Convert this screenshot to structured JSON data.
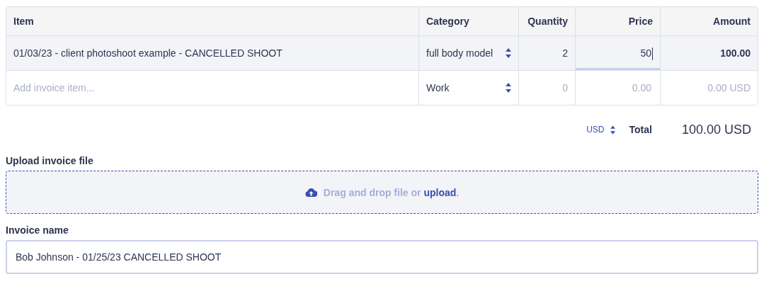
{
  "table": {
    "columns": [
      {
        "label": "Item"
      },
      {
        "label": "Category"
      },
      {
        "label": "Quantity"
      },
      {
        "label": "Price"
      },
      {
        "label": "Amount"
      }
    ],
    "rows": [
      {
        "kind": "item",
        "item": {
          "value": "01/03/23 - client photoshoot example - CANCELLED SHOOT"
        },
        "category": "full body model",
        "quantity": {
          "value": "2"
        },
        "price": {
          "value": "50",
          "focused": true
        },
        "amount": {
          "value": "100.00"
        }
      },
      {
        "kind": "new",
        "item": {
          "placeholder": "Add invoice item..."
        },
        "category": "Work",
        "quantity": {
          "placeholder": "0"
        },
        "price": {
          "placeholder": "0.00",
          "focused": false
        },
        "amount": {
          "placeholder": "0.00 USD"
        }
      }
    ]
  },
  "totals": {
    "currency": "USD",
    "label": "Total",
    "value": "100.00 USD"
  },
  "upload": {
    "label": "Upload invoice file",
    "prompt": "Drag and drop file or",
    "link": "upload",
    "suffix": "."
  },
  "invoice_name": {
    "label": "Invoice name",
    "value": "Bob Johnson - 01/25/23 CANCELLED SHOOT"
  }
}
